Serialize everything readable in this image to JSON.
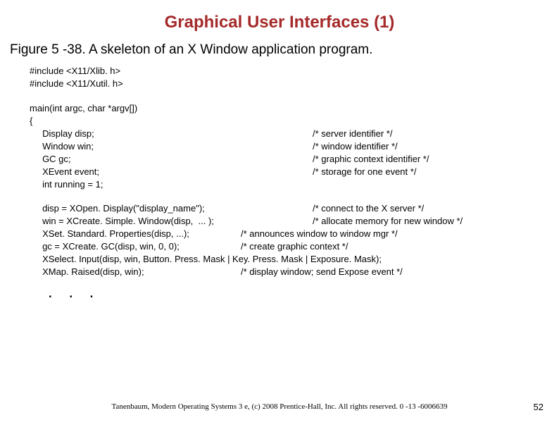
{
  "title": "Graphical User Interfaces (1)",
  "caption": "Figure 5 -38. A skeleton of an X Window application program.",
  "code": {
    "includes": [
      "#include <X11/Xlib. h>",
      "#include <X11/Xutil. h>"
    ],
    "main_sig": "main(int argc, char *argv[])",
    "brace_open": "{",
    "decls": [
      {
        "text": "Display disp;",
        "comment": "/* server identifier */"
      },
      {
        "text": "Window win;",
        "comment": "/* window identifier */"
      },
      {
        "text": "GC gc;",
        "comment": "/* graphic context identifier */"
      },
      {
        "text": "XEvent event;",
        "comment": "/* storage for one event */"
      },
      {
        "text": "int running = 1;",
        "comment": ""
      }
    ],
    "calls": [
      {
        "text": "disp = XOpen. Display(\"display_name\");",
        "comment": "/* connect to the X server */"
      },
      {
        "text": "win = XCreate. Simple. Window(disp,  ... );",
        "comment": "/* allocate memory for new window */"
      },
      {
        "text": "XSet. Standard. Properties(disp, ...);",
        "comment": "/* announces window to window mgr */",
        "short": true
      },
      {
        "text": "gc = XCreate. GC(disp, win, 0, 0);",
        "comment": "/* create graphic context */",
        "short": true
      },
      {
        "text": "XSelect. Input(disp, win, Button. Press. Mask | Key. Press. Mask | Exposure. Mask);",
        "comment": ""
      },
      {
        "text": "XMap. Raised(disp, win);",
        "comment": "/* display window; send Expose event */",
        "short": true
      }
    ]
  },
  "ellipsis": ". . .",
  "footer": "Tanenbaum, Modern Operating Systems 3 e, (c) 2008 Prentice-Hall, Inc. All rights reserved. 0 -13 -6006639",
  "page": "52"
}
